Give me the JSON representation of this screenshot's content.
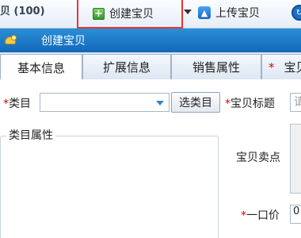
{
  "toolbar": {
    "left_text": "贝 (100)",
    "create_label": "创建宝贝",
    "upload_label": "上传宝贝"
  },
  "window": {
    "title": "创建宝贝"
  },
  "tabs": [
    {
      "label": "基本信息",
      "active": true
    },
    {
      "label": "扩展信息",
      "active": false
    },
    {
      "label": "销售属性",
      "active": false
    },
    {
      "label": "宝贝",
      "active": false,
      "required": true
    }
  ],
  "form": {
    "category_label": "类目",
    "category_value": "",
    "pick_category_button": "选类目",
    "item_title_label": "宝贝标题",
    "item_title_placeholder": "请",
    "category_attributes_label": "类目属性",
    "selling_points_label": "宝贝卖点",
    "price_label": "一口价",
    "price_value": "0",
    "required_mark": "*"
  },
  "colors": {
    "title_bar": "#1a78c8",
    "highlight": "#e33333",
    "required": "#d00000"
  },
  "icons": {
    "create": "plus-icon",
    "upload": "upload-arrow-icon",
    "window": "app-icon"
  }
}
